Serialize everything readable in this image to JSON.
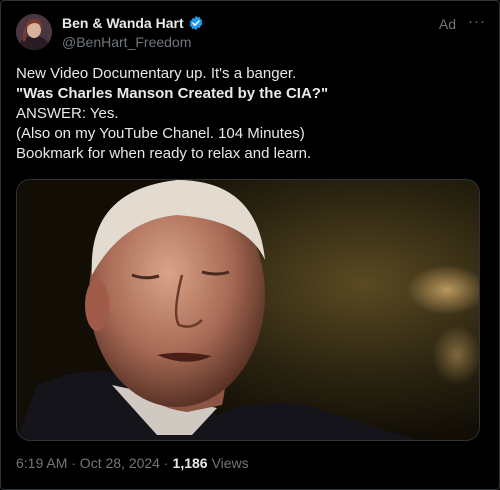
{
  "author": {
    "display_name": "Ben & Wanda Hart",
    "handle": "@BenHart_Freedom"
  },
  "ad_label": "Ad",
  "more_label": "···",
  "tweet": {
    "line1": "New Video Documentary up.  It's a banger.",
    "line2": "\"Was Charles Manson Created by the CIA?\"",
    "line3": "ANSWER: Yes.",
    "line4": "(Also on my YouTube Chanel. 104 Minutes)",
    "line5": "Bookmark for when ready to relax and learn."
  },
  "meta": {
    "timestamp": "6:19 AM · Oct 28, 2024 ·",
    "views_count": "1,186",
    "views_label": "Views"
  },
  "colors": {
    "verified": "#1d9bf0",
    "muted": "#71767b"
  }
}
